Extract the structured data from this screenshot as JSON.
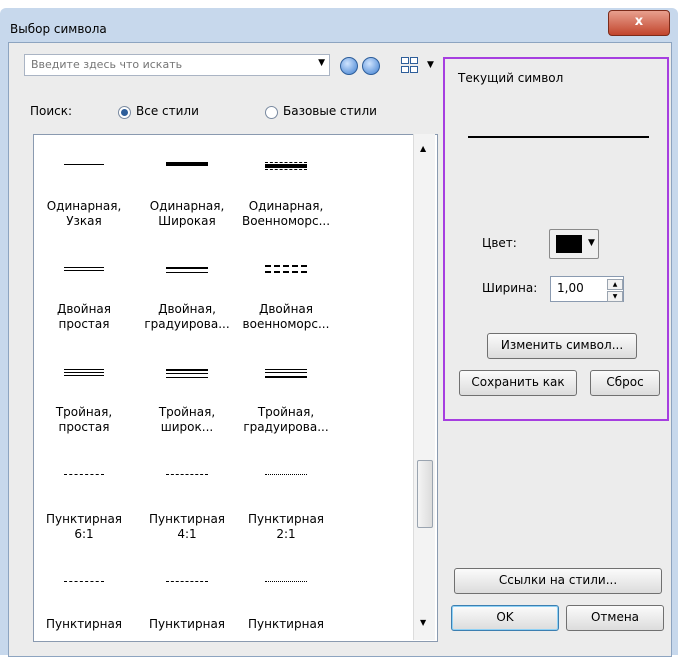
{
  "window": {
    "title": "Выбор символа",
    "close_glyph": "x"
  },
  "search": {
    "placeholder": "Введите здесь что искать"
  },
  "filter": {
    "label": "Поиск:",
    "option_all": "Все стили",
    "option_base": "Базовые стили",
    "selected": "Все стили"
  },
  "symbols": [
    {
      "line1": "Одинарная,",
      "line2": "Узкая",
      "style": "single-thin"
    },
    {
      "line1": "Одинарная,",
      "line2": "Широкая",
      "style": "single-wide"
    },
    {
      "line1": "Одинарная,",
      "line2": "Военноморс...",
      "style": "single-naval"
    },
    {
      "line1": "Двойная",
      "line2": "простая",
      "style": "double-simple"
    },
    {
      "line1": "Двойная,",
      "line2": "градуирова...",
      "style": "double-graded"
    },
    {
      "line1": "Двойная",
      "line2": "военноморс...",
      "style": "double-naval"
    },
    {
      "line1": "Тройная,",
      "line2": "простая",
      "style": "triple-simple"
    },
    {
      "line1": "Тройная,",
      "line2": "широк...",
      "style": "triple-wide"
    },
    {
      "line1": "Тройная,",
      "line2": "градуирова...",
      "style": "triple-graded"
    },
    {
      "line1": "Пунктирная",
      "line2": "6:1",
      "style": "dash-6-1"
    },
    {
      "line1": "Пунктирная",
      "line2": "4:1",
      "style": "dash-4-1"
    },
    {
      "line1": "Пунктирная",
      "line2": "2:1",
      "style": "dash-2-1"
    },
    {
      "line1": "Пунктирная",
      "line2": "",
      "style": "dash-long"
    },
    {
      "line1": "Пунктирная",
      "line2": "",
      "style": "dash-mid"
    },
    {
      "line1": "Пунктирная",
      "line2": "",
      "style": "dash-dot"
    }
  ],
  "current_symbol": {
    "legend": "Текущий символ",
    "color_label": "Цвет:",
    "color_value": "#000000",
    "width_label": "Ширина:",
    "width_value": "1,00",
    "edit_button": "Изменить символ...",
    "save_as_button": "Сохранить как",
    "reset_button": "Сброс"
  },
  "footer": {
    "styles_button": "Ссылки на стили...",
    "ok_button": "OK",
    "cancel_button": "Отмена"
  }
}
